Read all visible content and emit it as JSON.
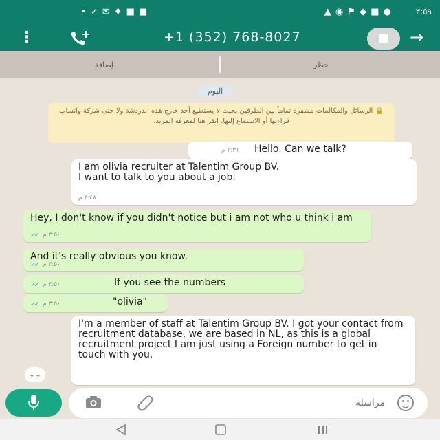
{
  "status_bar": {
    "left_text": "• ✓ ✉ ♦ ■ ■",
    "right_text": "▲ ◉ ⚑ ◆ ■ ●",
    "time": "٣:٥٩"
  },
  "header": {
    "title": "+1 (352) 768-8027",
    "back_icon": "arrow-right-icon",
    "call_icon": "add-call-icon",
    "menu_icon": "vertical-dots-icon"
  },
  "tabs": {
    "left": "إضافة",
    "right": "حظر"
  },
  "chat": {
    "date_chip": "اليوم",
    "notice": "🔒 الرسائل والمكالمات مشفرة تماماً بين الطرفين بحيث لا يستطيع أحد خارج هذه الدردشة ولا حتى شركة واتساب قراءتها أو الاستماع إليها. انقر هنا لمعرفة المزيد.",
    "messages": [
      {
        "dir": "out",
        "text": "Hello. Can we talk?",
        "time": "٢:٣١ م"
      },
      {
        "dir": "in",
        "text": "I am olivia recruiter at Talentim Group BV.\nI want to talk to you about a job.",
        "time": "٣:٤٨ م"
      },
      {
        "dir": "out",
        "text": "Hey, I don't know if you didn't notice but i am not who u think i am",
        "time": "٣:٥٠ م"
      },
      {
        "dir": "out",
        "text": "And it's really obvious you know.",
        "time": "٣:٥٠ م"
      },
      {
        "dir": "out",
        "text": "If you see the numbers",
        "time": "٣:٥٠ م"
      },
      {
        "dir": "out",
        "text": "\"olivia\"",
        "time": "٣:٥٠ م"
      },
      {
        "dir": "in",
        "text": "I'm a member of staff at Talentim Group BV. I got your contact from recruitment database, we are based in NL, as this is a global recruitment project I am just using a Foreign number to get in touch with you.",
        "time": ""
      }
    ]
  },
  "composer": {
    "placeholder": "مراسلة",
    "mic_icon": "microphone-icon",
    "camera_icon": "camera-icon",
    "attach_icon": "paperclip-icon",
    "emoji_icon": "smiley-icon"
  },
  "colors": {
    "header": "#0f7f6c",
    "outgoing_bubble": "#dcf8c6",
    "incoming_bubble": "#ffffff",
    "read_ticks": "#4fa3d8",
    "mic_button": "#17a884"
  }
}
